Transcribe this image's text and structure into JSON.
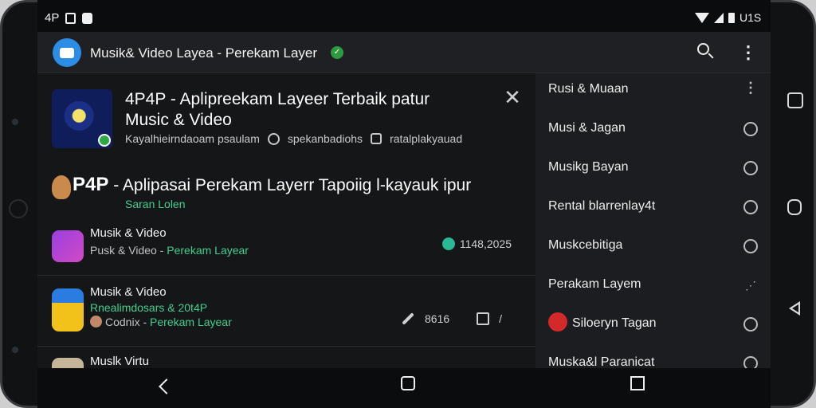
{
  "status_bar": {
    "left_text": "4P",
    "right_text": "U1S"
  },
  "app_bar": {
    "title": "Musik& Video  Layea  - Perekam Layer",
    "verified_mark": "✓",
    "search_icon": "search-icon",
    "more_icon": "more-vert-icon"
  },
  "featured": {
    "title_line1": "4P4P - Aplipreekam Layeer Terbaik patur",
    "title_line2": "Music & Video",
    "meta_left": "Kayalhieirndaoam psaulam",
    "meta_mid": "spekanbadiohs",
    "meta_right": "ratalplakyauad",
    "close_icon": "close-icon"
  },
  "promo": {
    "title_prefix": "P4P",
    "title": " - Aplipasai Perekam Layerr Tapoiig l-kayauk ipur",
    "subtitle": "Saran Lolen"
  },
  "rows": [
    {
      "title": "Musik & Video",
      "sub_plain": "Pusk & Video  - ",
      "sub_accent": "Perekam Layear",
      "right_text": "1148,2025"
    },
    {
      "title": "Musik & Video",
      "extra": "Rnealimdosars & 20t4P",
      "sub_plain": "Codnix  - ",
      "sub_accent": "Perekam Layear",
      "action_count": "8616",
      "action_mark": "/"
    },
    {
      "title": "Muslk Virtu"
    }
  ],
  "side_menu": {
    "items": [
      {
        "label": "Rusi & Muaan",
        "icon": "more-vert-icon"
      },
      {
        "label": "Musi & Jagan",
        "icon": "slash-circle-icon"
      },
      {
        "label": "Musikg Bayan",
        "icon": "circle-icon"
      },
      {
        "label": "Rental blarrenlay4t",
        "icon": "slash-circle-icon"
      },
      {
        "label": "Muskcebitiga",
        "icon": "circle-icon"
      },
      {
        "label": "Perakam Layem",
        "icon": "sparkle-icon"
      },
      {
        "label": "Siloeryn Tagan",
        "icon": "slash-circle-icon"
      },
      {
        "label": "Muska&l Paranicat",
        "icon": "circle-icon"
      }
    ]
  },
  "colors": {
    "accent_green": "#3fcf8e",
    "app_bar_bg": "#1f2023",
    "list_bg": "#151618",
    "side_bg": "#1c1d20"
  }
}
